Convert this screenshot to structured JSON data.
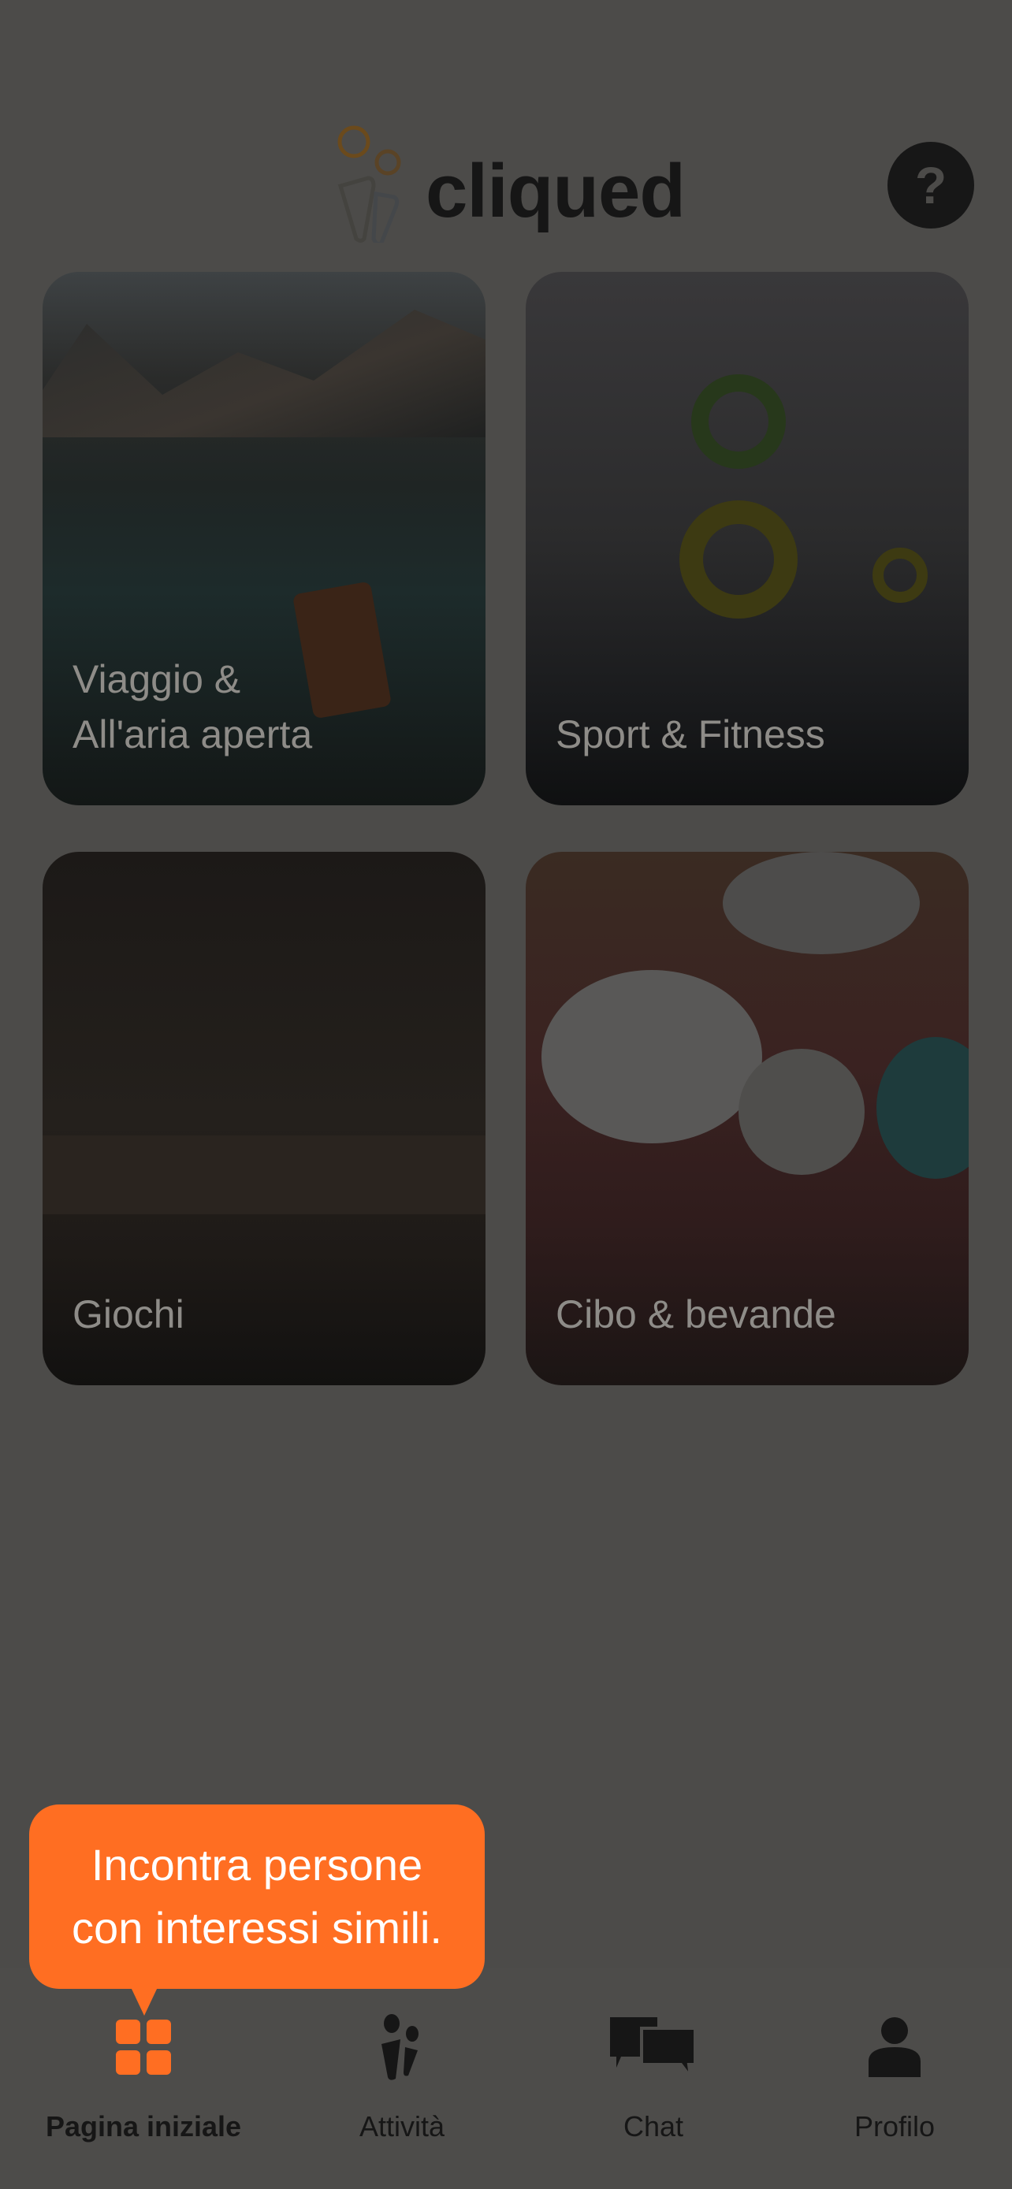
{
  "header": {
    "logo_text": "cliqued",
    "help_icon": "question-mark-icon",
    "help_label": "?"
  },
  "categories": [
    {
      "label": "Viaggio &\nAll'aria aperta"
    },
    {
      "label": "Sport & Fitness"
    },
    {
      "label": "Giochi"
    },
    {
      "label": "Cibo & bevande"
    }
  ],
  "tooltip": {
    "text": "Incontra persone\ncon interessi simili."
  },
  "nav": {
    "items": [
      {
        "label": "Pagina iniziale",
        "icon": "grid-icon",
        "active": true
      },
      {
        "label": "Attività",
        "icon": "people-icon"
      },
      {
        "label": "Chat",
        "icon": "chat-bubbles-icon"
      },
      {
        "label": "Profilo",
        "icon": "person-icon"
      }
    ]
  },
  "colors": {
    "accent": "#ff6e22",
    "overlay_background": "#4c4b49"
  }
}
